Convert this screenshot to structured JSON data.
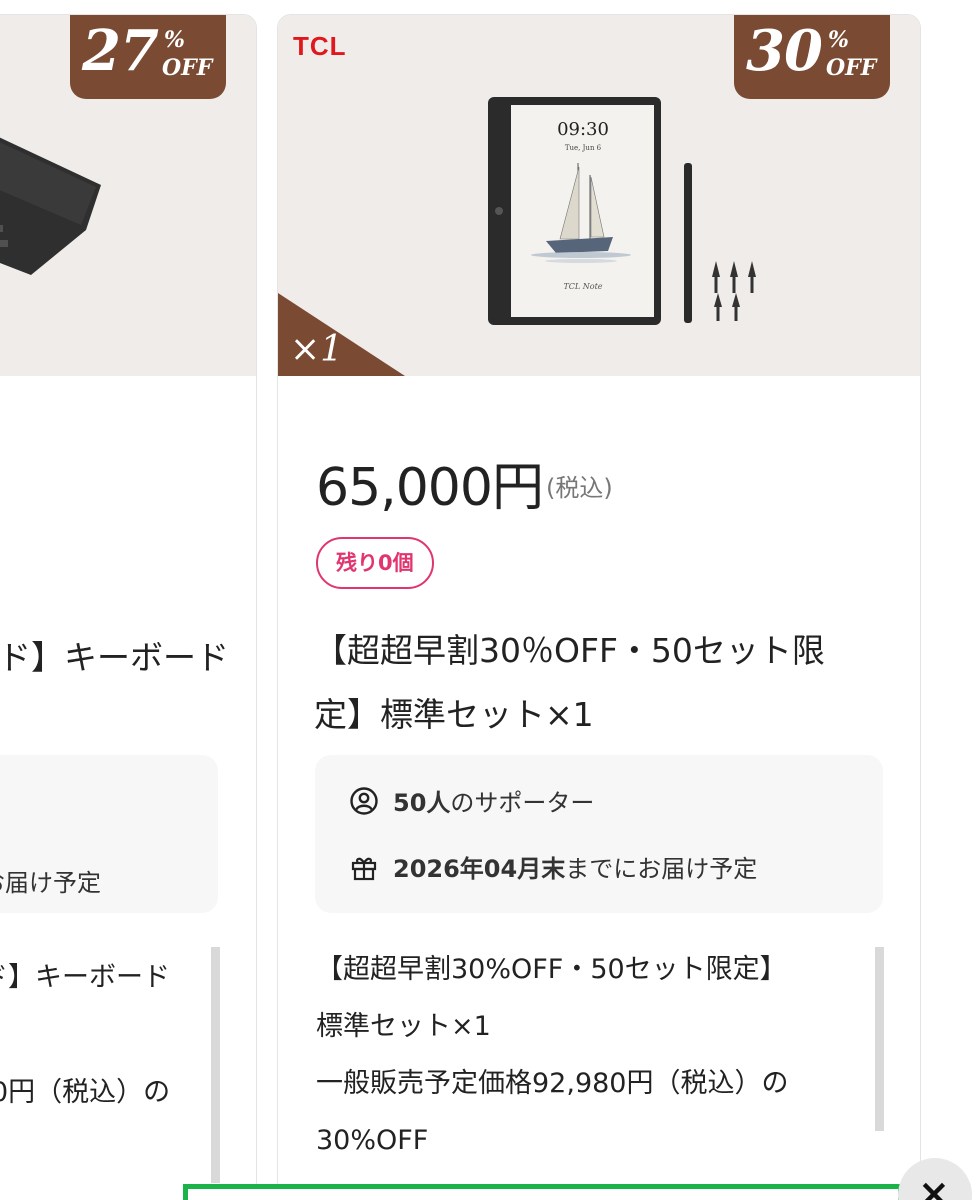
{
  "left_card": {
    "discount": {
      "number": "27",
      "percent": "%",
      "off": "OFF"
    },
    "title_fragment": "ド】キーボード",
    "delivery_fragment": "お届け予定",
    "desc_fragment_1": "ド】キーボード",
    "desc_fragment_2": "0円（税込）の"
  },
  "right_card": {
    "brand": "TCL",
    "discount": {
      "number": "30",
      "percent": "%",
      "off": "OFF"
    },
    "quantity_tag": "×1",
    "device_screen": {
      "time": "09:30",
      "date": "Tue, Jun 6",
      "signature": "TCL Note"
    },
    "price": "65,000円",
    "tax_label": "(税込)",
    "stock_badge": "残り0個",
    "title": "【超超早割30％OFF・50セット限定】標準セット×1",
    "supporters": {
      "count": "50人",
      "suffix": "のサポーター"
    },
    "delivery": {
      "date": "2026年04月末",
      "suffix": "までにお届け予定"
    },
    "description": [
      "【超超早割30%OFF・50セット限定】",
      "標準セット×1",
      "一般販売予定価格92,980円（税込）の",
      "30%OFF"
    ]
  },
  "overlay": {
    "close_label": "×"
  },
  "colors": {
    "discount_brown": "#7a4a33",
    "brand_red": "#e1171e",
    "stock_pink": "#e0356e",
    "bar_green": "#19b34a"
  }
}
